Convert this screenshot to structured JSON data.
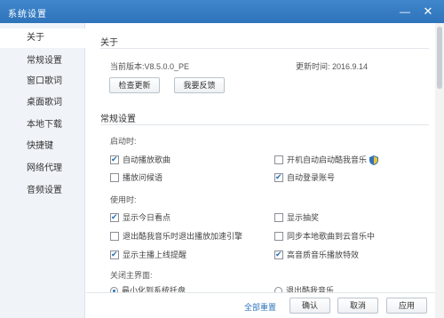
{
  "window": {
    "title": "系统设置"
  },
  "sidebar": {
    "items": [
      {
        "label": "关于",
        "active": true
      },
      {
        "label": "常规设置"
      },
      {
        "label": "窗口歌词"
      },
      {
        "label": "桌面歌词"
      },
      {
        "label": "本地下载"
      },
      {
        "label": "快捷键"
      },
      {
        "label": "网络代理"
      },
      {
        "label": "音频设置"
      }
    ]
  },
  "about": {
    "title": "关于",
    "version": "当前版本:V8.5.0.0_PE",
    "update_time": "更新时间: 2016.9.14",
    "check_update": "检查更新",
    "feedback": "我要反馈"
  },
  "general": {
    "title": "常规设置",
    "startup_label": "启动时:",
    "startup": [
      {
        "label": "自动播放歌曲",
        "checked": true
      },
      {
        "label": "开机自动启动酷我音乐",
        "checked": false,
        "icon": "shield-icon"
      },
      {
        "label": "播放问候语",
        "checked": false
      },
      {
        "label": "自动登录账号",
        "checked": true
      }
    ],
    "usage_label": "使用时:",
    "usage": [
      {
        "label": "显示今日看点",
        "checked": true
      },
      {
        "label": "显示抽奖",
        "checked": false
      },
      {
        "label": "退出酷我音乐时退出播放加速引擎",
        "checked": false
      },
      {
        "label": "同步本地歌曲到云音乐中",
        "checked": false
      },
      {
        "label": "显示主播上线提醒",
        "checked": true
      },
      {
        "label": "高音质音乐播放特效",
        "checked": true
      }
    ],
    "close_label": "关闭主界面:",
    "close_options": [
      {
        "label": "最小化到系统托盘",
        "selected": true
      },
      {
        "label": "退出酷我音乐",
        "selected": false
      }
    ]
  },
  "footer": {
    "reset": "全部重置",
    "ok": "确认",
    "cancel": "取消",
    "apply": "应用"
  },
  "colors": {
    "titlebar": "#2f74bb",
    "accent": "#2f74bb"
  }
}
